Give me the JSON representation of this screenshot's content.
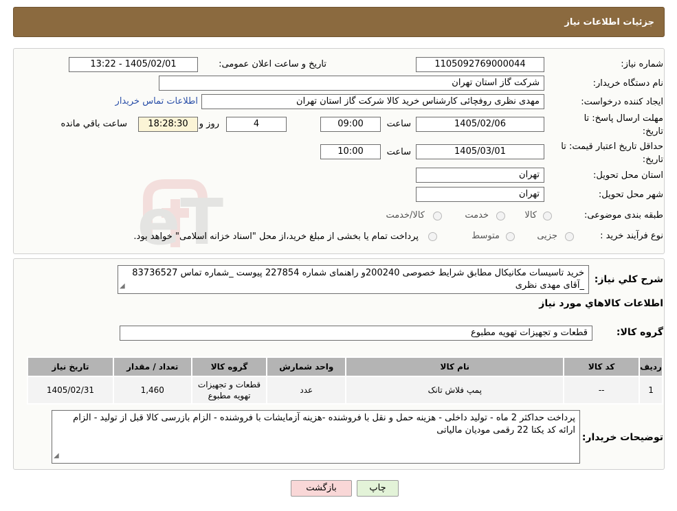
{
  "header": {
    "title": "جزئیات اطلاعات نیاز"
  },
  "fields": {
    "need_number": {
      "label": "شماره نیاز:",
      "value": "1105092769000044"
    },
    "announce_datetime": {
      "label": "تاریخ و ساعت اعلان عمومی:",
      "value": "1405/02/01 - 13:22"
    },
    "buyer_org": {
      "label": "نام دستگاه خریدار:",
      "value": "شرکت گاز استان تهران"
    },
    "requester": {
      "label": "ایجاد کننده درخواست:",
      "value": "مهدی نظری روفچائی کارشناس خرید کالا شرکت گاز استان تهران",
      "contact_link": "اطلاعات تماس خریدار"
    },
    "reply_deadline": {
      "label_line1": "مهلت ارسال پاسخ: تا",
      "label_line2": "تاریخ:",
      "date": "1405/02/06",
      "time_label": "ساعت",
      "time": "09:00",
      "days": "4",
      "days_label": "روز و",
      "remaining": "18:28:30",
      "remaining_label": "ساعت باقي مانده"
    },
    "price_validity": {
      "label_line1": "حداقل تاریخ اعتبار قیمت: تا",
      "label_line2": "تاریخ:",
      "date": "1405/03/01",
      "time_label": "ساعت",
      "time": "10:00"
    },
    "delivery_province": {
      "label": "استان محل تحویل:",
      "value": "تهران"
    },
    "delivery_city": {
      "label": "شهر محل تحویل:",
      "value": "تهران"
    },
    "category": {
      "label": "طبقه بندی موضوعی:",
      "options": [
        "کالا",
        "خدمت",
        "کالا/خدمت"
      ]
    },
    "purchase_type": {
      "label": "نوع فرآیند خرید :",
      "options": [
        "جزیی",
        "متوسط"
      ],
      "note": "پرداخت تمام یا بخشی از مبلغ خرید،از محل \"اسناد خزانه اسلامی\" خواهد بود."
    }
  },
  "summary": {
    "label": "شرح کلي نياز:",
    "text": "خرید تاسیسات مکانیکال مطابق شرایط خصوصی 200240و راهنمای شماره 227854 پیوست _شماره تماس 83736527 _آقای مهدی نظری"
  },
  "goods_info": {
    "title": "اطلاعات کالاهاي مورد نياز",
    "group_label": "گروه کالا:",
    "group_value": "قطعات و تجهیزات تهویه مطبوع"
  },
  "table": {
    "headers": [
      "رديف",
      "کد کالا",
      "نام کالا",
      "واحد شمارش",
      "گروه کالا",
      "تعداد / مقدار",
      "تاریخ نیاز"
    ],
    "rows": [
      [
        "1",
        "--",
        "پمپ فلاش تانک",
        "عدد",
        "قطعات و تجهیزات تهویه مطبوع",
        "1,460",
        "1405/02/31"
      ]
    ]
  },
  "buyer_notes": {
    "label": "توضیحات خریدار:",
    "text": "پرداخت حداکثر 2 ماه - تولید داخلی - هزینه حمل و نقل با فروشنده -هزینه آزمایشات با فروشنده - الزام بازرسی کالا قبل از تولید - الزام ارائه کد یکتا 22 رقمی مودیان مالیاتی"
  },
  "buttons": {
    "print": "چاپ",
    "back": "بازگشت"
  },
  "watermark": "AriaTender.neT",
  "colors": {
    "header": "#8b6a3f",
    "link": "#2a4fa8",
    "yellow_box": "#fbf4d6",
    "table_header": "#b4b4b4"
  }
}
